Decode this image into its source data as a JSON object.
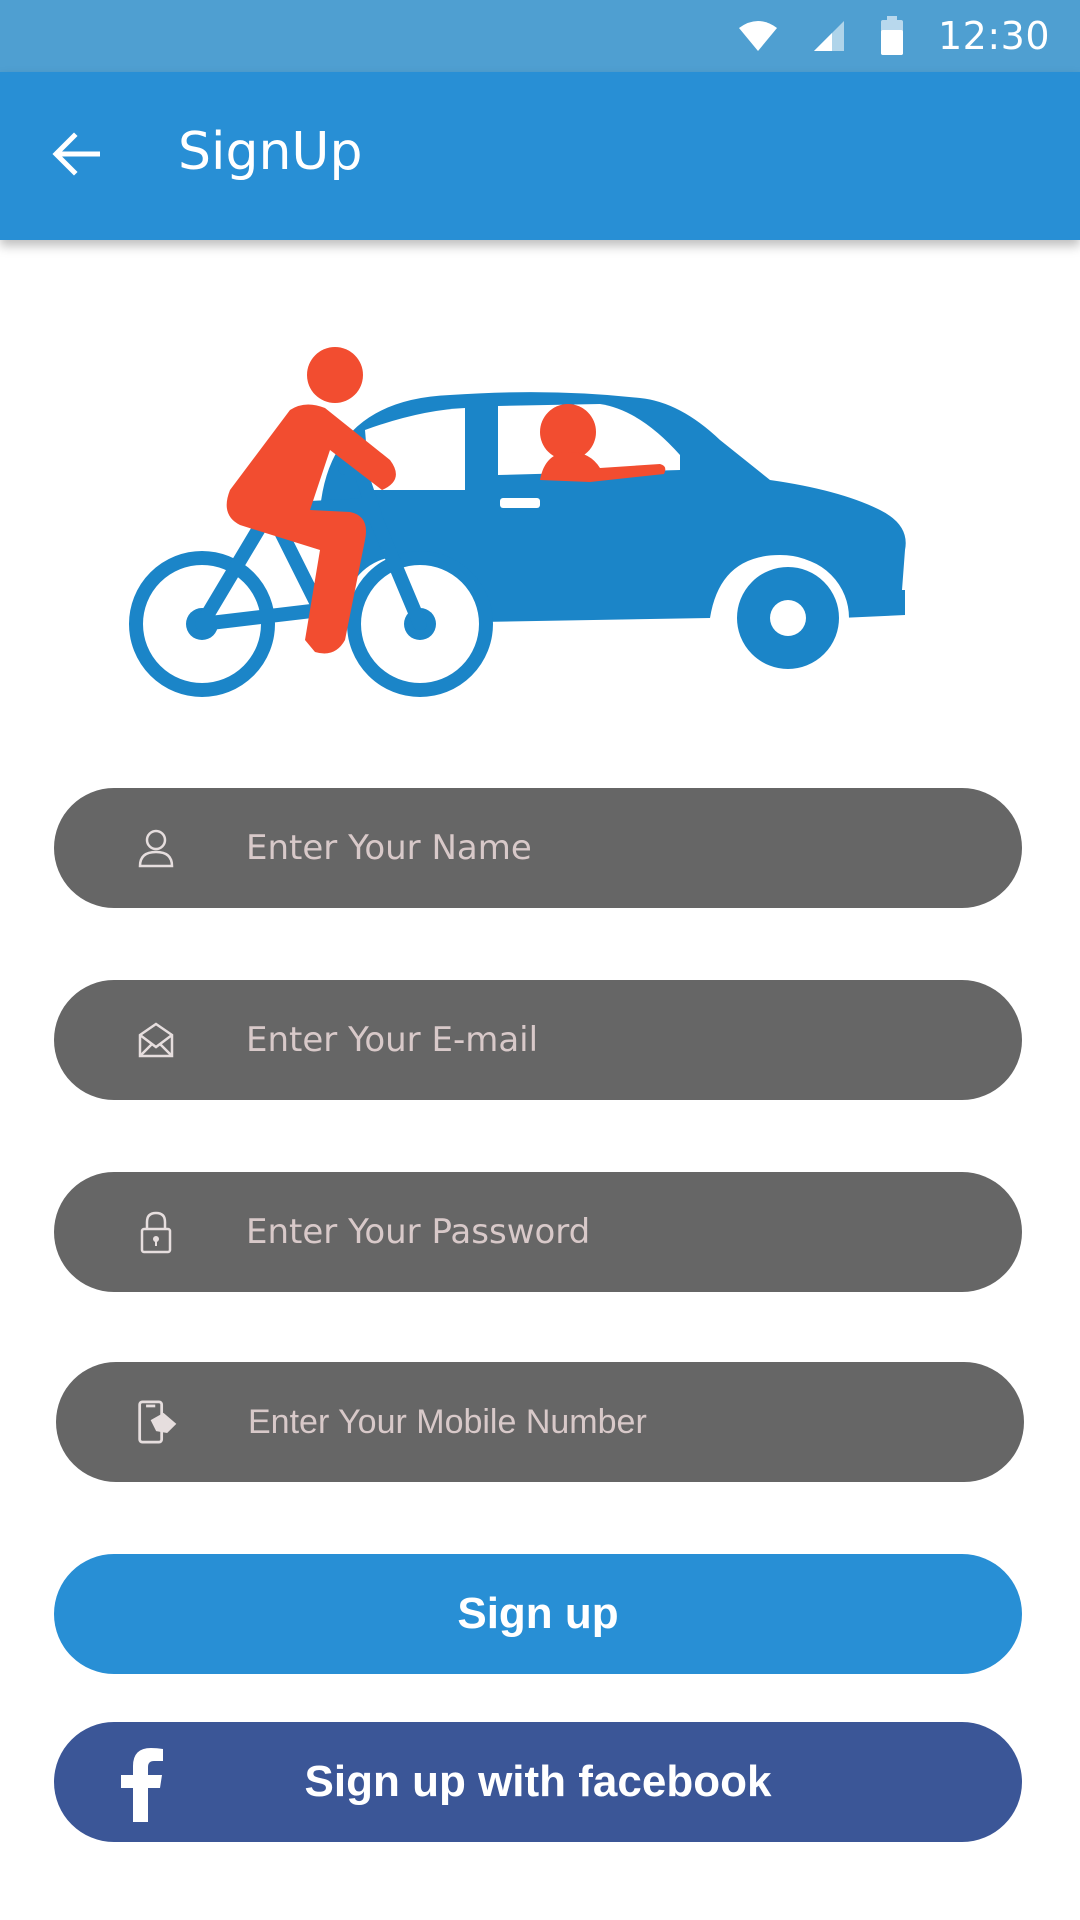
{
  "status_bar": {
    "time": "12:30",
    "icons": [
      "wifi-icon",
      "cell-signal-icon",
      "battery-icon"
    ],
    "background": "#4f9fd1"
  },
  "app_bar": {
    "title": "SignUp",
    "back_icon": "arrow-left-icon",
    "background": "#288fd5"
  },
  "hero": {
    "illustration": "cyclist-and-car-illustration",
    "colors": {
      "figure": "#f24d30",
      "vehicle": "#1b85c8"
    }
  },
  "form": {
    "fields": [
      {
        "icon": "user-icon",
        "placeholder": "Enter Your Name",
        "value": ""
      },
      {
        "icon": "envelope-icon",
        "placeholder": "Enter Your E-mail",
        "value": ""
      },
      {
        "icon": "lock-icon",
        "placeholder": "Enter Your Password",
        "value": ""
      },
      {
        "icon": "mobile-phone-icon",
        "placeholder": "Enter Your Mobile Number",
        "value": ""
      }
    ],
    "field_background": "#666666",
    "placeholder_color": "#d8c9c9"
  },
  "buttons": {
    "signup_label": "Sign up",
    "facebook_label": "Sign up with facebook",
    "facebook_icon": "facebook-icon",
    "signup_color": "#288fd5",
    "facebook_color": "#3b5697"
  }
}
